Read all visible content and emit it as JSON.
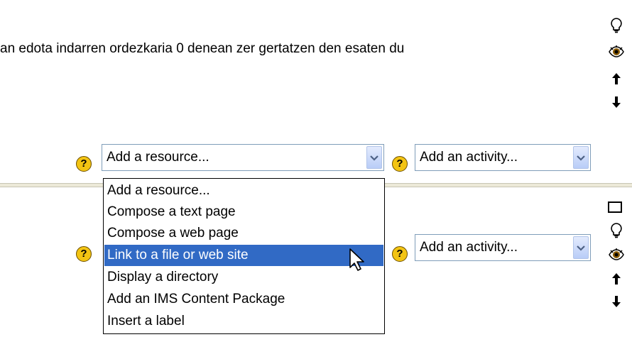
{
  "description_text": "an edota indarren ordezkaria 0 denean zer gertatzen den esaten du",
  "section1": {
    "resource_select": {
      "value": "Add a resource..."
    },
    "activity_select": {
      "value": "Add an activity..."
    }
  },
  "section2": {
    "activity_select": {
      "value": "Add an activity..."
    }
  },
  "dropdown": {
    "items": [
      {
        "label": "Add a resource..."
      },
      {
        "label": "Compose a text page"
      },
      {
        "label": "Compose a web page"
      },
      {
        "label": "Link to a file or web site",
        "selected": true
      },
      {
        "label": "Display a directory"
      },
      {
        "label": "Add an IMS Content Package"
      },
      {
        "label": "Insert a label"
      }
    ]
  },
  "help_icon_glyph": "?",
  "right_icons": [
    "lightbulb-icon",
    "eye-icon",
    "arrow-up-icon",
    "arrow-down-icon",
    "square-icon"
  ],
  "colors": {
    "selection": "#316ac5",
    "help_bg": "#f3c413",
    "select_border": "#7f9db9"
  }
}
